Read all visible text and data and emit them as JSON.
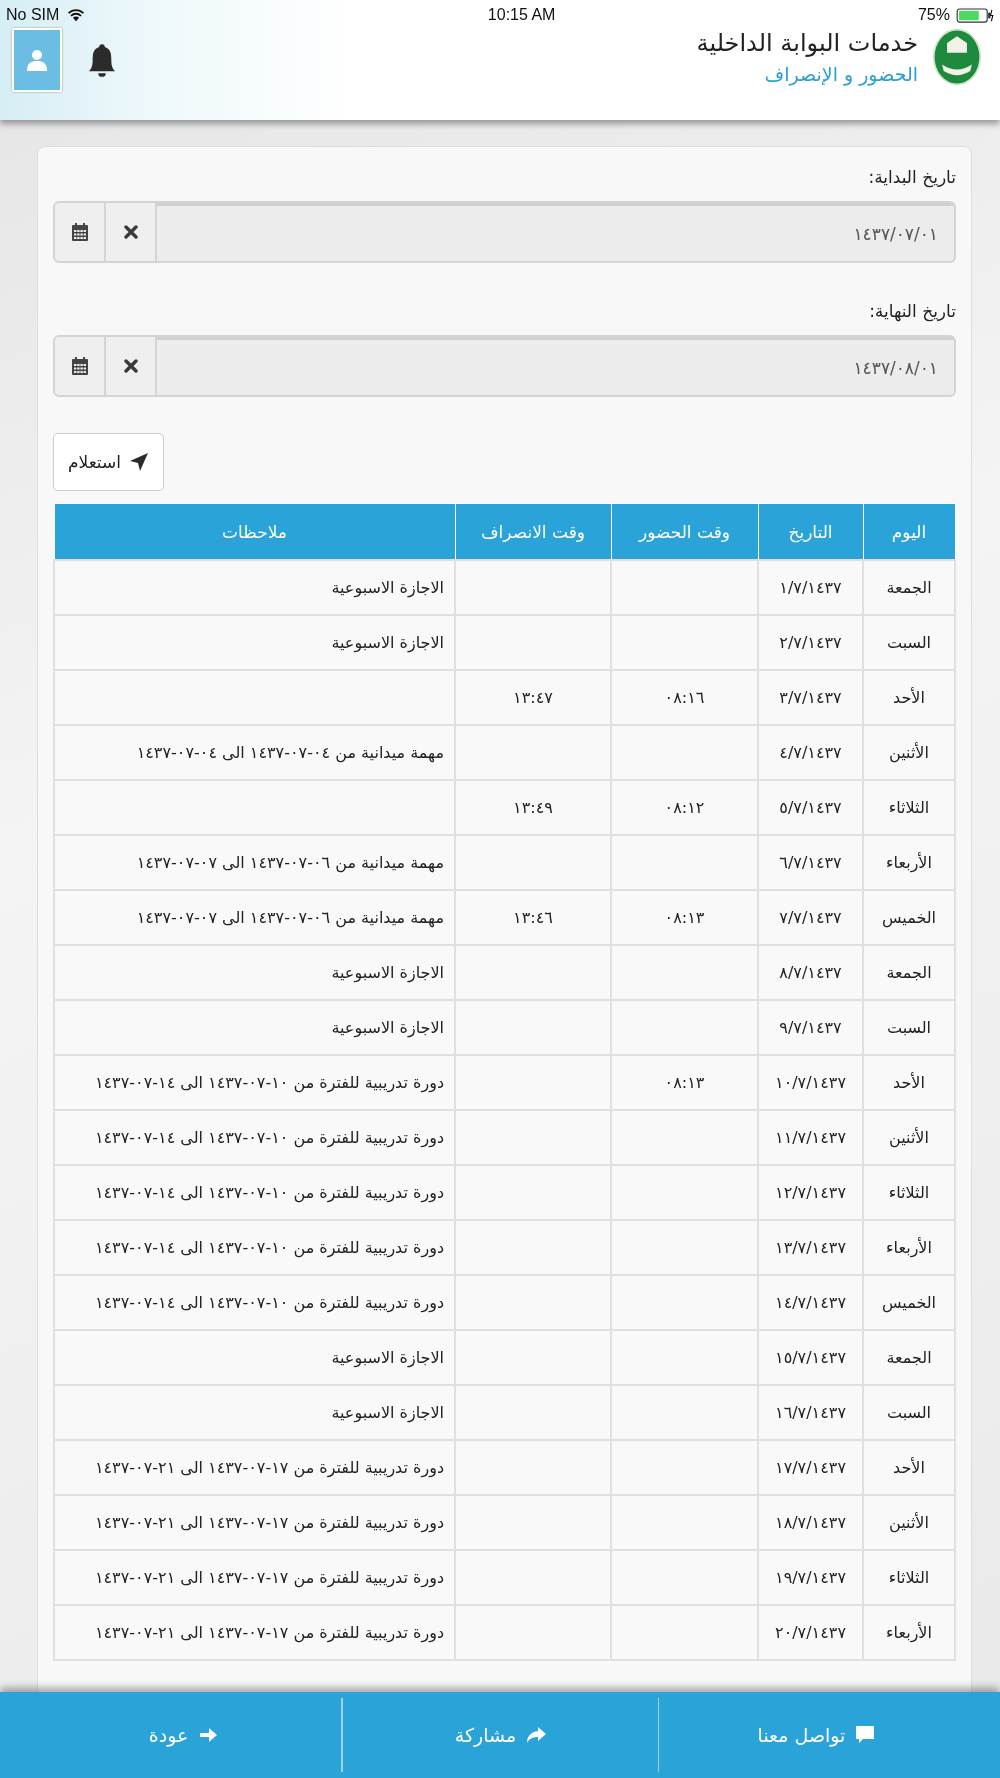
{
  "status_bar": {
    "carrier": "No SIM",
    "time": "10:15 AM",
    "battery": "75%"
  },
  "header": {
    "title": "خدمات البوابة الداخلية",
    "subtitle": "الحضور و الإنصراف"
  },
  "form": {
    "fields": [
      {
        "label": "تاريخ البداية:",
        "value": "١٤٣٧/٠٧/٠١"
      },
      {
        "label": "تاريخ النهاية:",
        "value": "١٤٣٧/٠٨/٠١"
      }
    ],
    "submit": "استعلام"
  },
  "table": {
    "columns": [
      "اليوم",
      "التاريخ",
      "وقت الحضور",
      "وقت الانصراف",
      "ملاحظات"
    ],
    "rows": [
      {
        "day": "الجمعة",
        "date": "١/٧/١٤٣٧",
        "notes": "الاجازة الاسبوعية"
      },
      {
        "day": "السبت",
        "date": "٢/٧/١٤٣٧",
        "notes": "الاجازة الاسبوعية"
      },
      {
        "day": "الأحد",
        "date": "٣/٧/١٤٣٧",
        "time_in": "٠٨:١٦",
        "time_out": "١٣:٤٧"
      },
      {
        "day": "الأثنين",
        "date": "٤/٧/١٤٣٧",
        "notes": "مهمة ميدانية من ٠٤-٠٧-١٤٣٧ الى ٠٤-٠٧-١٤٣٧"
      },
      {
        "day": "الثلاثاء",
        "date": "٥/٧/١٤٣٧",
        "time_in": "٠٨:١٢",
        "time_out": "١٣:٤٩"
      },
      {
        "day": "الأربعاء",
        "date": "٦/٧/١٤٣٧",
        "notes": "مهمة ميدانية من ٠٦-٠٧-١٤٣٧ الى ٠٧-٠٧-١٤٣٧"
      },
      {
        "day": "الخميس",
        "date": "٧/٧/١٤٣٧",
        "time_in": "٠٨:١٣",
        "time_out": "١٣:٤٦",
        "notes": "مهمة ميدانية من ٠٦-٠٧-١٤٣٧ الى ٠٧-٠٧-١٤٣٧"
      },
      {
        "day": "الجمعة",
        "date": "٨/٧/١٤٣٧",
        "notes": "الاجازة الاسبوعية"
      },
      {
        "day": "السبت",
        "date": "٩/٧/١٤٣٧",
        "notes": "الاجازة الاسبوعية"
      },
      {
        "day": "الأحد",
        "date": "١٠/٧/١٤٣٧",
        "time_in": "٠٨:١٣",
        "notes": "دورة تدريبية للفترة من ١٠-٠٧-١٤٣٧ الى ١٤-٠٧-١٤٣٧"
      },
      {
        "day": "الأثنين",
        "date": "١١/٧/١٤٣٧",
        "notes": "دورة تدريبية للفترة من ١٠-٠٧-١٤٣٧ الى ١٤-٠٧-١٤٣٧"
      },
      {
        "day": "الثلاثاء",
        "date": "١٢/٧/١٤٣٧",
        "notes": "دورة تدريبية للفترة من ١٠-٠٧-١٤٣٧ الى ١٤-٠٧-١٤٣٧"
      },
      {
        "day": "الأربعاء",
        "date": "١٣/٧/١٤٣٧",
        "notes": "دورة تدريبية للفترة من ١٠-٠٧-١٤٣٧ الى ١٤-٠٧-١٤٣٧"
      },
      {
        "day": "الخميس",
        "date": "١٤/٧/١٤٣٧",
        "notes": "دورة تدريبية للفترة من ١٠-٠٧-١٤٣٧ الى ١٤-٠٧-١٤٣٧"
      },
      {
        "day": "الجمعة",
        "date": "١٥/٧/١٤٣٧",
        "notes": "الاجازة الاسبوعية"
      },
      {
        "day": "السبت",
        "date": "١٦/٧/١٤٣٧",
        "notes": "الاجازة الاسبوعية"
      },
      {
        "day": "الأحد",
        "date": "١٧/٧/١٤٣٧",
        "notes": "دورة تدريبية للفترة من ١٧-٠٧-١٤٣٧ الى ٢١-٠٧-١٤٣٧"
      },
      {
        "day": "الأثنين",
        "date": "١٨/٧/١٤٣٧",
        "notes": "دورة تدريبية للفترة من ١٧-٠٧-١٤٣٧ الى ٢١-٠٧-١٤٣٧"
      },
      {
        "day": "الثلاثاء",
        "date": "١٩/٧/١٤٣٧",
        "notes": "دورة تدريبية للفترة من ١٧-٠٧-١٤٣٧ الى ٢١-٠٧-١٤٣٧"
      },
      {
        "day": "الأربعاء",
        "date": "٢٠/٧/١٤٣٧",
        "notes": "دورة تدريبية للفترة من ١٧-٠٧-١٤٣٧ الى ٢١-٠٧-١٤٣٧"
      }
    ]
  },
  "bottom_bar": [
    {
      "label": "تواصل معنا",
      "kind": "contact"
    },
    {
      "label": "مشاركة",
      "kind": "share"
    },
    {
      "label": "عودة",
      "kind": "back"
    }
  ]
}
